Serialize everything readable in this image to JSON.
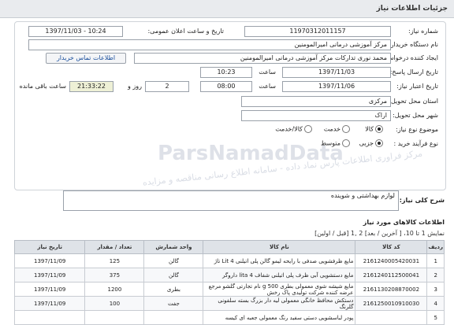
{
  "header": {
    "title": "جزئیات اطلاعات نیاز"
  },
  "form": {
    "need_number_label": "شماره نیاز:",
    "need_number": "1197031201115‌7",
    "announce_label": "تاریخ و ساعت اعلان عمومی:",
    "announce_value": "1397/11/03 - 10:24",
    "buyer_label": "نام دستگاه خریدار:",
    "buyer_value": "مرکز آموزشی درمانی امیرالمومنین",
    "creator_label": "ایجاد کننده درخواست:",
    "creator_value": "محمد نوری تدارکات مرکز آموزشی درمانی امیرالمومنین",
    "contact_link": "اطلاعات تماس خریدار",
    "send_date_label": "تاریخ ارسال پاسخ:",
    "send_date": "1397/11/03",
    "time_word": "ساعت",
    "send_time": "10:23",
    "validity_label": "تاریخ اعتبار نیاز:",
    "validity_date": "1397/11/06",
    "validity_time": "08:00",
    "days": "2",
    "days_word": "روز و",
    "remaining_time": "21:33:22",
    "remaining_label": "ساعت باقی مانده",
    "province_label": "استان محل تحویل:",
    "province": "مرکزی",
    "city_label": "شهر محل تحویل:",
    "city": "اراک",
    "category_label": "موضوع نوع نیاز:",
    "cat_goods": "کالا",
    "cat_service": "خدمت",
    "cat_both": "کالا/خدمت",
    "process_label": "نوع فرآیند خرید :",
    "proc_partial": "جزیی",
    "proc_medium": "متوسط"
  },
  "description": {
    "label": "شرح کلی نیاز:",
    "value": "لوازم بهداشتی و شوینده"
  },
  "goods": {
    "section_title": "اطلاعات کالاهای مورد نیاز",
    "paging": "نمایش 1 تا 10، [ آخرین / بعد] 2 ,1 [قبل / اولین]",
    "headers": [
      "ردیف",
      "کد کالا",
      "نام کالا",
      "واحد شمارش",
      "تعداد / مقدار",
      "تاریخ نیاز"
    ],
    "rows": [
      {
        "idx": "1",
        "code": "2161240005420031",
        "name": "مایع ظرفشویی صدفی با رایحه لیمو گالن پلی اتیلنی Lit 4 تاژ",
        "unit": "گالن",
        "qty": "125",
        "date": "1397/11/09"
      },
      {
        "idx": "2",
        "code": "2161240112500041",
        "name": "مایع دستشویی آبی ظرف پلی اتیلنی شفاف 4 lita داروگر",
        "unit": "گالن",
        "qty": "375",
        "date": "1397/11/09"
      },
      {
        "idx": "3",
        "code": "2161130208870002",
        "name": "مایع شیشه شوی معمولی بطری 500 g نام تجارتی گلشو مرجع عرضه کننده شرکت تولیدی پاک رخش",
        "unit": "بطری",
        "qty": "1200",
        "date": "1397/11/09"
      },
      {
        "idx": "4",
        "code": "2161250010910030",
        "name": "دستکش محافظ خانگی معمولی لیه دار بزرگ بسته سلفونی گلرنگ",
        "unit": "جفت",
        "qty": "100",
        "date": "1397/11/09"
      },
      {
        "idx": "5",
        "code": "",
        "name": "پودر لباسشویی دستی سفید رنگ معمولی جعبه ای کیسه",
        "unit": "",
        "qty": "",
        "date": ""
      }
    ]
  },
  "watermark": {
    "brand": "ParsNamadData",
    "tagline": "مرکز فراوری اطلاعات پارس نماد داده - سامانه اطلاع رسانی مناقصه و مزایده"
  }
}
